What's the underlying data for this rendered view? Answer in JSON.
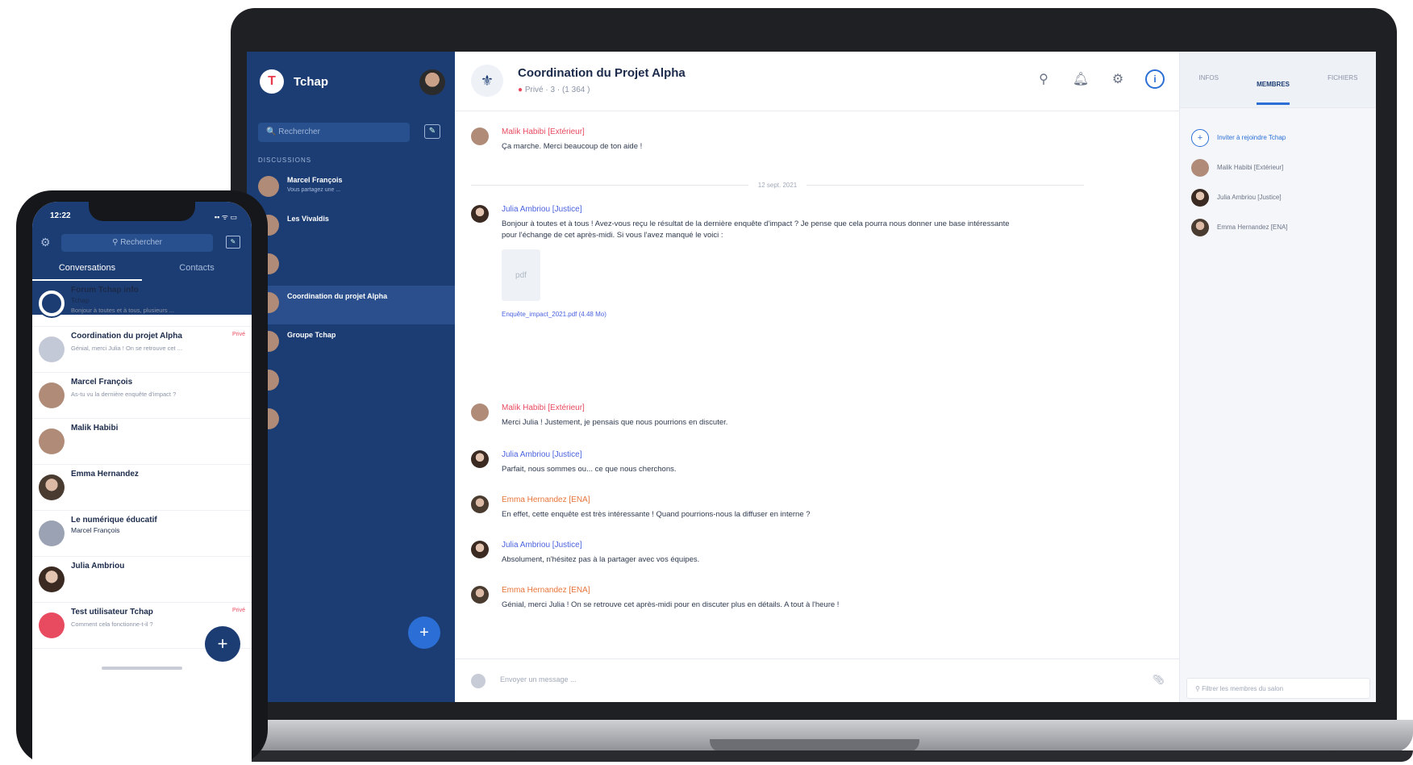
{
  "desktop": {
    "sidebar": {
      "brand": "Tchap",
      "search_placeholder": "Rechercher",
      "section_title": "DISCUSSIONS",
      "conversations": [
        {
          "name": "Marcel François",
          "preview": "Vous partagez une ...",
          "time": ""
        },
        {
          "name": "Les Vivaldis",
          "preview": "",
          "time": ""
        },
        {
          "name": "",
          "preview": "",
          "time": ""
        },
        {
          "name": "Coordination du projet Alpha",
          "preview": "",
          "time": ""
        },
        {
          "name": "Groupe Tchap",
          "preview": "",
          "time": ""
        },
        {
          "name": "",
          "preview": "",
          "time": ""
        },
        {
          "name": "",
          "preview": "",
          "time": ""
        }
      ],
      "fab": "+",
      "footer": ""
    },
    "chat": {
      "title": "Coordination du Projet Alpha",
      "subtitle_status": "Privé",
      "subtitle_rest": "· 3 · (1 364 )",
      "divider": "12 sept. 2021",
      "messages": [
        {
          "author": "Malik Habibi [Extérieur]",
          "text": "Ça marche. Merci beaucoup de ton aide !"
        },
        {
          "author": "Julia Ambriou [Justice]",
          "text": "Bonjour à toutes et à tous ! Avez-vous reçu le résultat de la dernière enquête d'impact ? Je pense que cela pourra nous donner une base intéressante pour l'échange de cet après-midi. Si vous l'avez manqué le voici :",
          "attachment": "Enquête_impact_2021.pdf (4.48 Mo)"
        },
        {
          "author": "Malik Habibi [Extérieur]",
          "text": "Merci Julia ! Justement, je pensais que nous pourrions en discuter."
        },
        {
          "author": "Julia Ambriou [Justice]",
          "text": "Parfait, nous sommes ou... ce que nous cherchons."
        },
        {
          "author": "Emma Hernandez [ENA]",
          "text": "En effet, cette enquête est très intéressante ! Quand pourrions-nous la diffuser en interne ?"
        },
        {
          "author": "Julia Ambriou [Justice]",
          "text": "Absolument, n'hésitez pas à la partager avec vos équipes."
        },
        {
          "author": "Emma Hernandez [ENA]",
          "text": "Génial, merci Julia ! On se retrouve cet après-midi pour en discuter plus en détails. A tout à l'heure !"
        }
      ],
      "pdf_label": "pdf",
      "composer_placeholder": "Envoyer un message ..."
    },
    "right_panel": {
      "tabs": [
        "INFOS",
        "MEMBRES",
        "FICHIERS"
      ],
      "members": [
        {
          "name": "Inviter à rejoindre Tchap"
        },
        {
          "name": "Malik Habibi [Extérieur]"
        },
        {
          "name": "Julia Ambriou [Justice]"
        },
        {
          "name": "Emma Hernandez [ENA]"
        }
      ],
      "filter_placeholder": "Filtrer les membres du salon"
    }
  },
  "mobile": {
    "status_time": "12:22",
    "status_icons": "▪▪ ᯤ ▭",
    "search_placeholder": "Rechercher",
    "tabs": [
      "Conversations",
      "Contacts"
    ],
    "conversations": [
      {
        "name": "Forum Tchap info",
        "sub": "Tchap",
        "preview": "Bonjour à toutes et à tous, plusieurs ...",
        "badge": "",
        "time": ""
      },
      {
        "name": "Coordination du projet Alpha",
        "sub": "",
        "preview": "Génial, merci Julia ! On se retrouve cet ...",
        "badge": "Privé",
        "time": ""
      },
      {
        "name": "Marcel François",
        "sub": "",
        "preview": "As-tu vu la dernière enquête d'impact ?",
        "badge": "",
        "time": ""
      },
      {
        "name": "Malik Habibi",
        "sub": "",
        "preview": "",
        "badge": "",
        "time": ""
      },
      {
        "name": "Emma Hernandez",
        "sub": "",
        "preview": "",
        "badge": "",
        "time": ""
      },
      {
        "name": "Le numérique éducatif",
        "sub": "Marcel François",
        "preview": "",
        "badge": "",
        "time": ""
      },
      {
        "name": "Julia Ambriou",
        "sub": "",
        "preview": "",
        "badge": "",
        "time": ""
      },
      {
        "name": "Test utilisateur Tchap",
        "sub": "",
        "preview": "Comment cela fonctionne-t-il ?",
        "badge": "Privé",
        "time": ""
      }
    ],
    "fab": "+"
  },
  "colors": {
    "navy": "#1c3d73",
    "accent_blue": "#2b6fd6",
    "red": "#e84a5f",
    "author_blue": "#4a62e0",
    "author_orange": "#e8743a"
  }
}
